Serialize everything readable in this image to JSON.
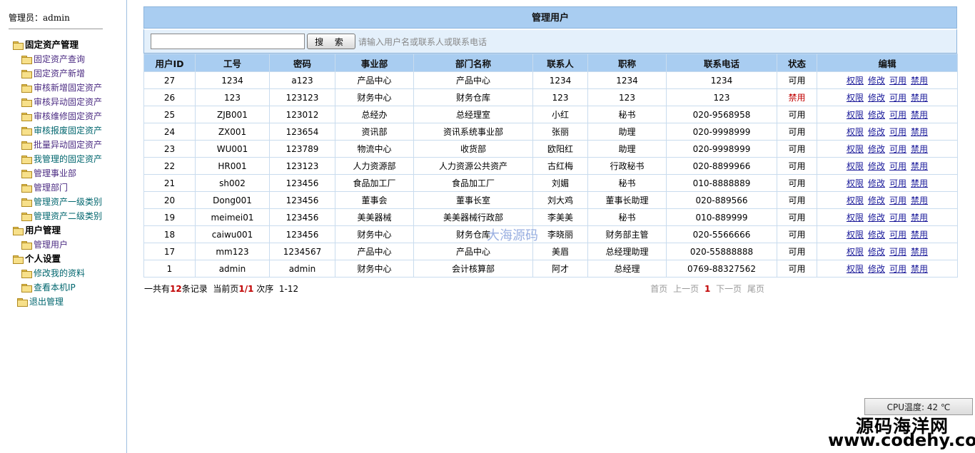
{
  "sidebar": {
    "admin_label": "管理员：",
    "admin_name": "admin",
    "groups": [
      {
        "title": "固定资产管理",
        "items": [
          "固定资产查询",
          "固定资产新增",
          "审核新增固定资产",
          "审核异动固定资产",
          "审核维修固定资产",
          "审核报废固定资产",
          "批量异动固定资产",
          "我管理的固定资产",
          "管理事业部",
          "管理部门",
          "管理资产一级类别",
          "管理资产二级类别"
        ]
      },
      {
        "title": "用户管理",
        "items": [
          "管理用户"
        ]
      },
      {
        "title": "个人设置",
        "items": [
          "修改我的资料",
          "查看本机IP"
        ]
      }
    ],
    "exit_label": "退出管理"
  },
  "panel": {
    "title": "管理用户"
  },
  "search": {
    "button_label": "搜 索",
    "hint": "请输入用户名或联系人或联系电话",
    "value": ""
  },
  "table": {
    "headers": [
      "用户ID",
      "工号",
      "密码",
      "事业部",
      "部门名称",
      "联系人",
      "职称",
      "联系电话",
      "状态",
      "编辑"
    ],
    "ops": [
      "权限",
      "修改",
      "可用",
      "禁用"
    ],
    "rows": [
      [
        "27",
        "1234",
        "a123",
        "产品中心",
        "产品中心",
        "1234",
        "1234",
        "1234",
        "可用"
      ],
      [
        "26",
        "123",
        "123123",
        "财务中心",
        "财务仓库",
        "123",
        "123",
        "123",
        "禁用"
      ],
      [
        "25",
        "ZJB001",
        "123012",
        "总经办",
        "总经理室",
        "小红",
        "秘书",
        "020-9568958",
        "可用"
      ],
      [
        "24",
        "ZX001",
        "123654",
        "资讯部",
        "资讯系统事业部",
        "张丽",
        "助理",
        "020-9998999",
        "可用"
      ],
      [
        "23",
        "WU001",
        "123789",
        "物流中心",
        "收货部",
        "欧阳红",
        "助理",
        "020-9998999",
        "可用"
      ],
      [
        "22",
        "HR001",
        "123123",
        "人力资源部",
        "人力资源公共资产",
        "古红梅",
        "行政秘书",
        "020-8899966",
        "可用"
      ],
      [
        "21",
        "sh002",
        "123456",
        "食品加工厂",
        "食品加工厂",
        "刘媚",
        "秘书",
        "010-8888889",
        "可用"
      ],
      [
        "20",
        "Dong001",
        "123456",
        "董事会",
        "董事长室",
        "刘大鸡",
        "董事长助理",
        "020-889566",
        "可用"
      ],
      [
        "19",
        "meimei01",
        "123456",
        "美美器械",
        "美美器械行政部",
        "李美美",
        "秘书",
        "010-889999",
        "可用"
      ],
      [
        "18",
        "caiwu001",
        "123456",
        "财务中心",
        "财务仓库",
        "李晓丽",
        "财务部主管",
        "020-5566666",
        "可用"
      ],
      [
        "17",
        "mm123",
        "1234567",
        "产品中心",
        "产品中心",
        "美眉",
        "总经理助理",
        "020-55888888",
        "可用"
      ],
      [
        "1",
        "admin",
        "admin",
        "财务中心",
        "会计核算部",
        "阿才",
        "总经理",
        "0769-88327562",
        "可用"
      ]
    ]
  },
  "pager": {
    "prefix": "一共有",
    "total": "12",
    "mid": "条记录  当前页",
    "page": "1/1",
    "suffix": " 次序  1-12",
    "first": "首页",
    "prev": "上一页",
    "current": "1",
    "next": "下一页",
    "last": "尾页"
  },
  "watermark": {
    "center": "大海源码",
    "logo_line1": "源码海洋网",
    "logo_line2": "www.codehy.com"
  },
  "cpu": {
    "label": "CPU温度: 42 ℃"
  }
}
